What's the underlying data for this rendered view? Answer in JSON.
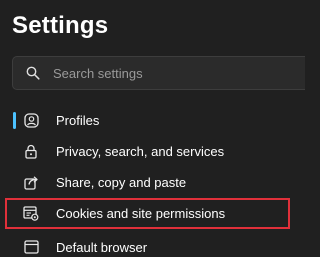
{
  "header": {
    "title": "Settings"
  },
  "search": {
    "placeholder": "Search settings",
    "icon": "search-icon"
  },
  "colors": {
    "background": "#202020",
    "accent": "#4cc2ff",
    "highlight_border": "#e0303a"
  },
  "sidebar": {
    "items": [
      {
        "label": "Profiles",
        "icon": "profile-icon",
        "active": true
      },
      {
        "label": "Privacy, search, and services",
        "icon": "lock-icon",
        "active": false
      },
      {
        "label": "Share, copy and paste",
        "icon": "share-icon",
        "active": false
      },
      {
        "label": "Cookies and site permissions",
        "icon": "cookies-permissions-icon",
        "active": false,
        "highlighted": true
      },
      {
        "label": "Default browser",
        "icon": "browser-icon",
        "active": false
      }
    ]
  }
}
